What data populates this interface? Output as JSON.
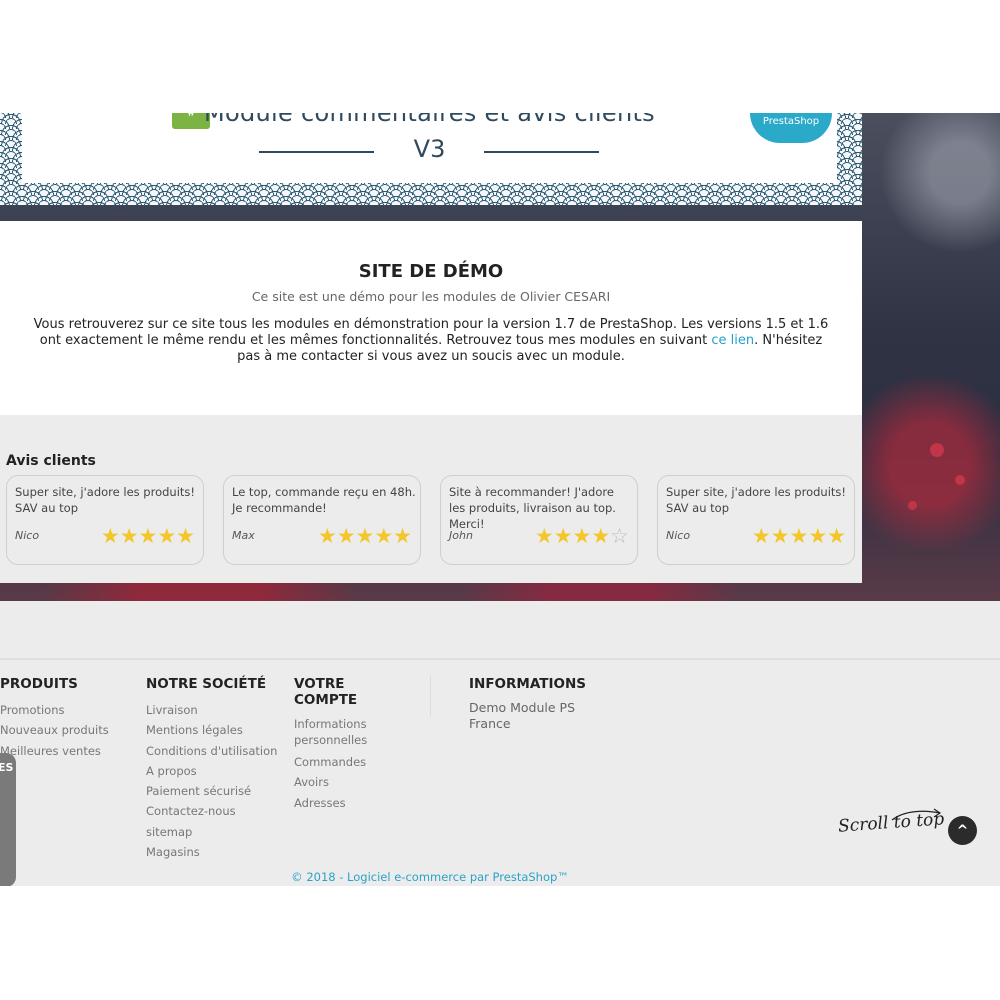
{
  "header": {
    "title": "Module commentaires et avis clients",
    "version": "V3",
    "badge": "PrestaShop"
  },
  "demo": {
    "title": "SITE DE DÉMO",
    "subtitle": "Ce site est une démo pour les modules de Olivier CESARI",
    "body_line1": "Vous retrouverez sur ce site tous les modules en démonstration pour la version 1.7 de PrestaShop. Les versions 1.5 et 1.6",
    "body_line2_before": "ont exactement le même rendu et les mêmes fonctionnalités. Retrouvez tous mes modules en suivant ",
    "body_link": "ce lien",
    "body_line2_after": ". N'hésitez",
    "body_line3": "pas à me contacter si vous avez un soucis avec un module."
  },
  "reviews": {
    "title": "Avis clients",
    "items": [
      {
        "text": "Super site, j'adore les produits! SAV au top",
        "author": "Nico",
        "rating": 5
      },
      {
        "text": "Le top, commande reçu en 48h. Je recommande!",
        "author": "Max",
        "rating": 5
      },
      {
        "text": "Site à recommander! J'adore les produits, livraison au top. Merci!",
        "author": "John",
        "rating": 4
      },
      {
        "text": "Super site, j'adore les produits! SAV au top",
        "author": "Nico",
        "rating": 5
      }
    ]
  },
  "footer": {
    "produits": {
      "title": "PRODUITS",
      "links": [
        "Promotions",
        "Nouveaux produits",
        "Meilleures ventes"
      ]
    },
    "societe": {
      "title": "NOTRE SOCIÉTÉ",
      "links": [
        "Livraison",
        "Mentions légales",
        "Conditions d'utilisation",
        "A propos",
        "Paiement sécurisé",
        "Contactez-nous",
        "sitemap",
        "Magasins"
      ]
    },
    "compte": {
      "title": "VOTRE COMPTE",
      "links": [
        "Informations personnelles",
        "Commandes",
        "Avoirs",
        "Adresses"
      ]
    },
    "informations": {
      "title": "INFORMATIONS",
      "line1": "Demo Module PS",
      "line2": "France"
    },
    "copyright": "© 2018 - Logiciel e-commerce par PrestaShop™",
    "side_tab": "ES",
    "scroll_label": "Scroll to top",
    "scroll_icon": "chevron-up-icon"
  },
  "colors": {
    "accent": "#29a3c6",
    "star": "#f3c62c",
    "wave": "#2c5a74"
  }
}
